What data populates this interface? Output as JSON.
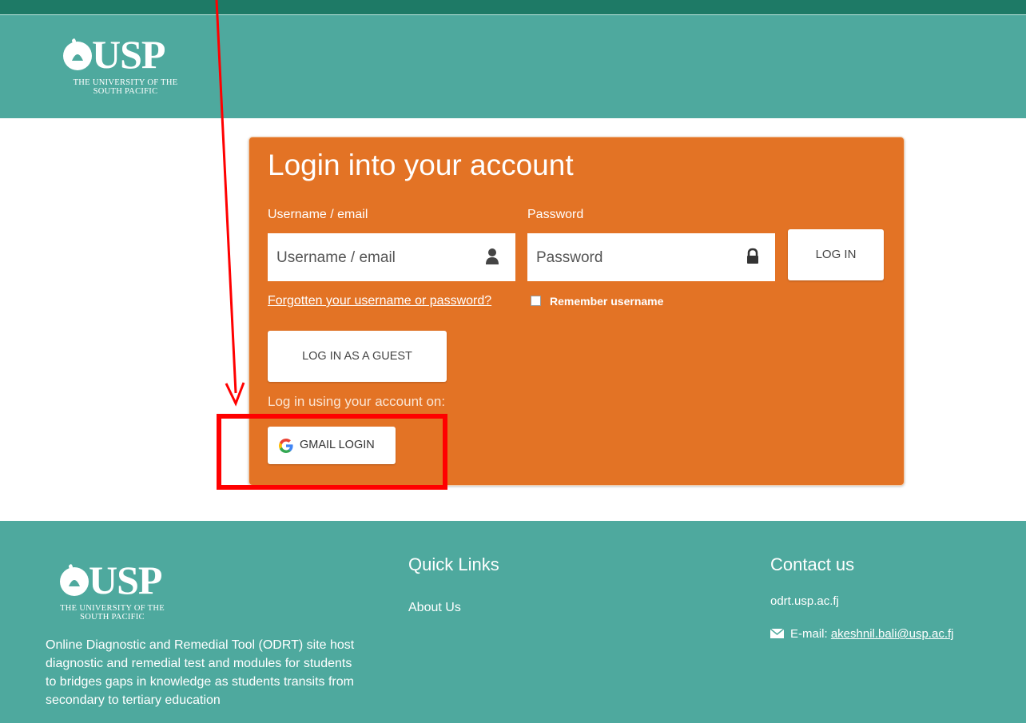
{
  "header": {
    "logo_text": "USP",
    "logo_subtitle_line1": "THE UNIVERSITY OF THE",
    "logo_subtitle_line2": "SOUTH PACIFIC"
  },
  "login": {
    "title": "Login into your account",
    "username_label": "Username / email",
    "username_placeholder": "Username / email",
    "password_label": "Password",
    "password_placeholder": "Password",
    "login_button": "LOG IN",
    "forgot_link": "Forgotten your username or password?",
    "remember_label": "Remember username",
    "guest_button": "LOG IN AS A GUEST",
    "alt_login_text": "Log in using your account on:",
    "gmail_button": "GMAIL LOGIN"
  },
  "footer": {
    "logo_text": "USP",
    "logo_subtitle_line1": "THE UNIVERSITY OF THE",
    "logo_subtitle_line2": "SOUTH PACIFIC",
    "description": "Online Diagnostic and Remedial Tool (ODRT) site host diagnostic and remedial test and modules for students to bridges gaps in knowledge as students transits from secondary to tertiary education",
    "quick_links_title": "Quick Links",
    "about_link": "About Us",
    "contact_title": "Contact us",
    "site_url": "odrt.usp.ac.fj",
    "email_prefix": "E-mail:",
    "email_address": "akeshnil.bali@usp.ac.fj"
  },
  "colors": {
    "teal": "#4ea99e",
    "dark_teal": "#1e7a66",
    "orange": "#e37325",
    "annotation_red": "#ff0000"
  },
  "icons": [
    "user-icon",
    "lock-icon",
    "google-icon",
    "envelope-icon",
    "usp-logo-mark"
  ]
}
